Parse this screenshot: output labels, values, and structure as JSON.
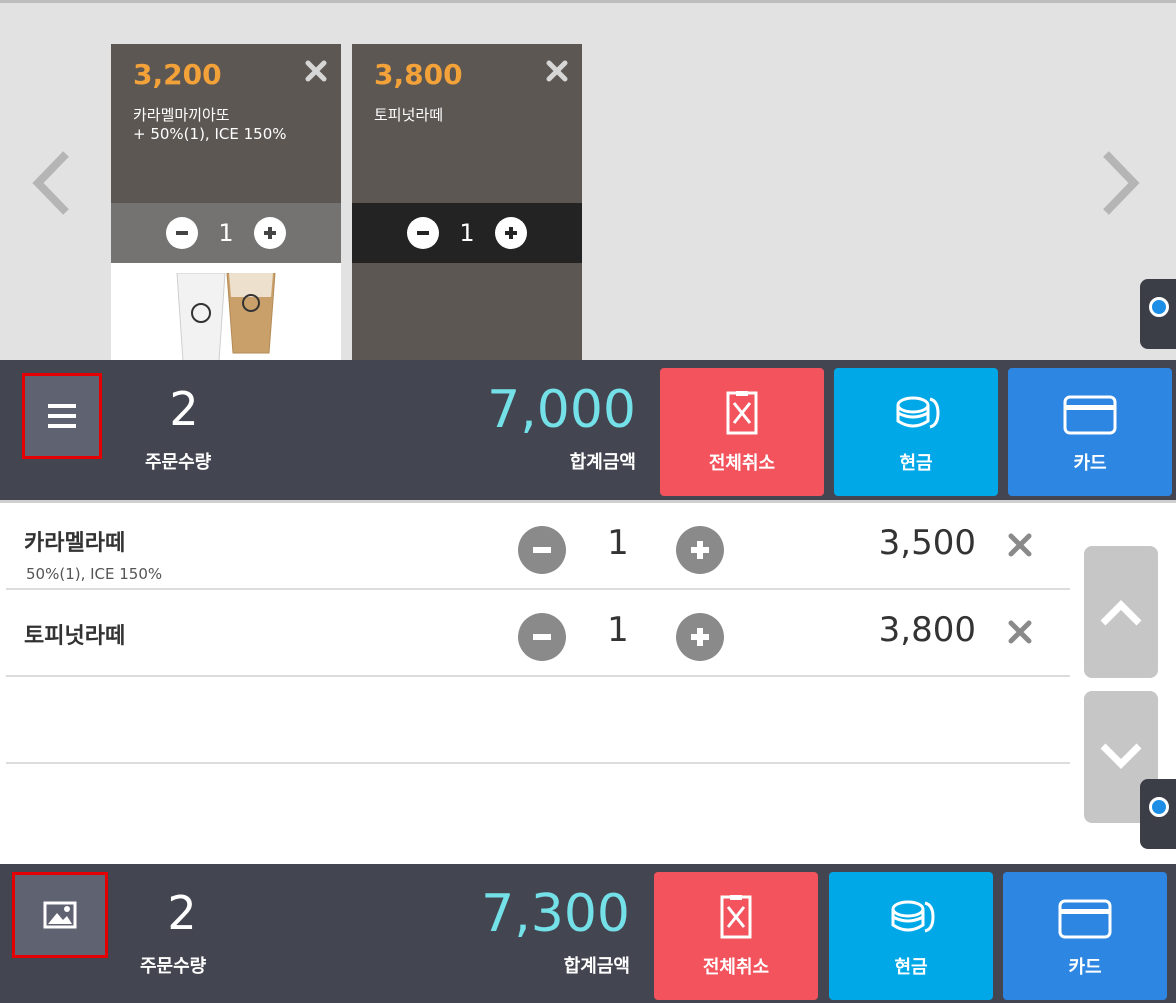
{
  "gallery": {
    "items": [
      {
        "price": "3,200",
        "name": "카라멜마끼아또\n+ 50%(1), ICE 150%",
        "qty": "1"
      },
      {
        "price": "3,800",
        "name": "토피넛라떼",
        "qty": "1"
      }
    ]
  },
  "bar_top": {
    "count": "2",
    "count_label": "주문수량",
    "total": "7,000",
    "total_label": "합계금액"
  },
  "bar_bottom": {
    "count": "2",
    "count_label": "주문수량",
    "total": "7,300",
    "total_label": "합계금액"
  },
  "actions": {
    "cancel": "전체취소",
    "cash": "현금",
    "card": "카드"
  },
  "orders": [
    {
      "name": "카라멜라떼",
      "options": "50%(1), ICE 150%",
      "qty": "1",
      "price": "3,500"
    },
    {
      "name": "토피넛라떼",
      "options": "",
      "qty": "1",
      "price": "3,800"
    }
  ],
  "colors": {
    "bar_bg": "#434550",
    "total_text": "#74e0e8",
    "price_orange": "#f3a23a",
    "cancel": "#f2535c",
    "cash": "#00a8e8",
    "card": "#2d86e2"
  },
  "icons": {
    "menu": "hamburger-icon",
    "image": "image-icon",
    "cancel": "receipt-x-icon",
    "cash": "coins-icon",
    "card": "credit-card-icon"
  }
}
